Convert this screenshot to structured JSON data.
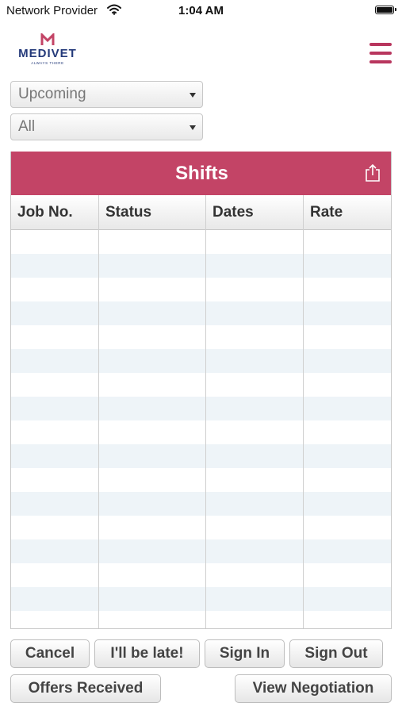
{
  "status_bar": {
    "carrier": "Network Provider",
    "time": "1:04 AM"
  },
  "header": {
    "logo_text": "MEDIVET",
    "logo_tagline": "ALWAYS THERE",
    "brand_color": "#c34466",
    "logo_color": "#243a7a"
  },
  "filters": {
    "period_selected": "Upcoming",
    "type_selected": "All"
  },
  "shifts_grid": {
    "title": "Shifts",
    "columns": [
      "Job No.",
      "Status",
      "Dates",
      "Rate"
    ],
    "rows": []
  },
  "actions": {
    "cancel": "Cancel",
    "late": "I'll be late!",
    "sign_in": "Sign In",
    "sign_out": "Sign Out",
    "offers_received": "Offers Received",
    "view_negotiation": "View Negotiation"
  }
}
